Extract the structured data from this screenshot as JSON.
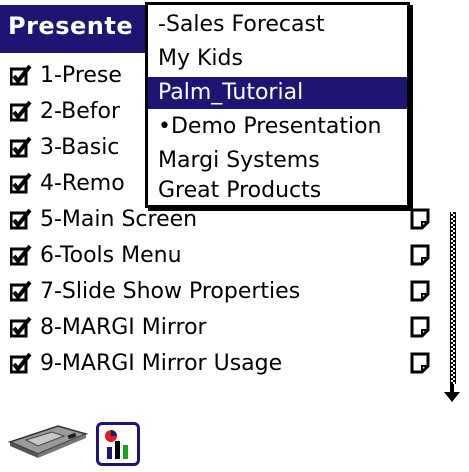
{
  "app": {
    "title": "Presente"
  },
  "slides": [
    {
      "label": "1-Prese",
      "checked": true
    },
    {
      "label": "2-Befor",
      "checked": true
    },
    {
      "label": "3-Basic",
      "checked": true
    },
    {
      "label": "4-Remo",
      "checked": true
    },
    {
      "label": "5-Main Screen",
      "checked": true,
      "note": true
    },
    {
      "label": "6-Tools Menu",
      "checked": true,
      "note": true
    },
    {
      "label": "7-Slide Show Properties",
      "checked": true,
      "note": true
    },
    {
      "label": "8-MARGI Mirror",
      "checked": true,
      "note": true
    },
    {
      "label": "9-MARGI Mirror Usage",
      "checked": true,
      "note": true
    }
  ],
  "dropdown": {
    "items": [
      {
        "label": "-Sales Forecast"
      },
      {
        "label": "My Kids"
      },
      {
        "label": "Palm_Tutorial",
        "selected": true
      },
      {
        "label": "•Demo Presentation"
      },
      {
        "label": "Margi Systems"
      },
      {
        "label": "Great Products"
      }
    ]
  },
  "icons": {
    "device": "margi-device-icon",
    "chart": "presentation-chart-icon",
    "checkbox": "checkbox-checked-icon",
    "note": "note-icon",
    "scroll": "scroll-down-arrow-icon"
  },
  "colors": {
    "accent": "#1e1474",
    "background": "#ffffff"
  }
}
